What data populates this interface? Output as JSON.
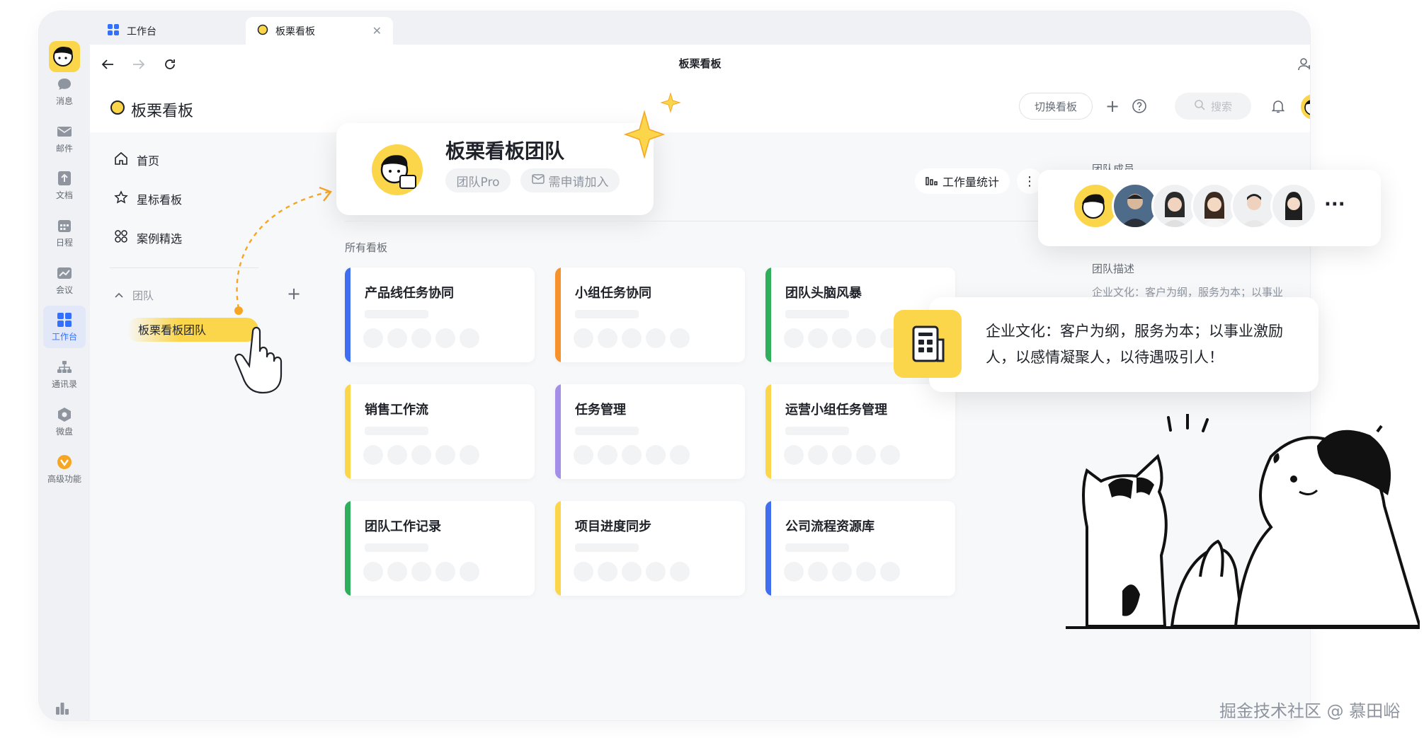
{
  "tabs": [
    {
      "label": "工作台",
      "icon": "workbench-icon"
    },
    {
      "label": "板栗看板",
      "icon": "chestnut-icon"
    }
  ],
  "nav": {
    "title": "板栗看板"
  },
  "rail": [
    {
      "label": "消息",
      "icon": "chat-icon"
    },
    {
      "label": "邮件",
      "icon": "mail-icon"
    },
    {
      "label": "文档",
      "icon": "doc-icon"
    },
    {
      "label": "日程",
      "icon": "calendar-icon"
    },
    {
      "label": "会议",
      "icon": "meeting-icon"
    },
    {
      "label": "工作台",
      "icon": "workbench-icon"
    },
    {
      "label": "通讯录",
      "icon": "contacts-icon"
    },
    {
      "label": "微盘",
      "icon": "drive-icon"
    },
    {
      "label": "高级功能",
      "icon": "advanced-icon"
    }
  ],
  "app": {
    "name": "板栗看板",
    "switch_label": "切换看板",
    "search_placeholder": "搜索"
  },
  "sidebar": {
    "items": [
      {
        "label": "首页",
        "icon": "home-icon"
      },
      {
        "label": "星标看板",
        "icon": "star-icon"
      },
      {
        "label": "案例精选",
        "icon": "cases-icon"
      }
    ],
    "team_section": "团队",
    "team_item": "板栗看板团队"
  },
  "team": {
    "name": "板栗看板团队",
    "tag_pro": "团队Pro",
    "tag_join": "需申请加入",
    "stats_label": "工作量统计"
  },
  "boards_label": "所有看板",
  "boards": [
    {
      "name": "产品线任务协同",
      "color": "#3f6ff0"
    },
    {
      "name": "小组任务协同",
      "color": "#f6912b"
    },
    {
      "name": "团队头脑风暴",
      "color": "#2fae5c"
    },
    {
      "name": "销售工作流",
      "color": "#fbd54a"
    },
    {
      "name": "任务管理",
      "color": "#a48ee8"
    },
    {
      "name": "运营小组任务管理",
      "color": "#fbd54a"
    },
    {
      "name": "团队工作记录",
      "color": "#2fae5c"
    },
    {
      "name": "项目进度同步",
      "color": "#fbd54a"
    },
    {
      "name": "公司流程资源库",
      "color": "#3f6ff0"
    }
  ],
  "members_label": "团队成员",
  "members_more": "···",
  "desc_label": "团队描述",
  "desc_text": "企业文化：客户为纲，服务为本；以事业",
  "culture_text": "企业文化：客户为纲，服务为本；以事业激励人，以感情凝聚人，以待遇吸引人！",
  "watermark": "掘金技术社区 @ 慕田峪",
  "colors": {
    "accent": "#fbd54a",
    "link": "#3370ff"
  }
}
